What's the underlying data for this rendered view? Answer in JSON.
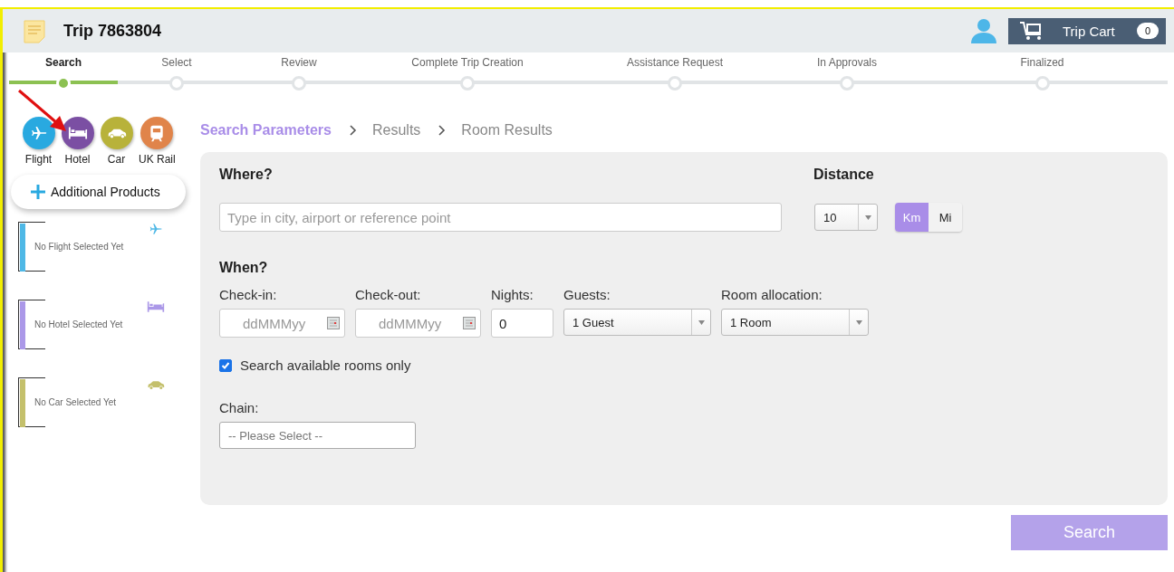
{
  "header": {
    "title": "Trip 7863804",
    "cart_label": "Trip Cart",
    "cart_count": "0"
  },
  "steps": [
    {
      "label": "Search",
      "selected": true
    },
    {
      "label": "Select",
      "selected": false
    },
    {
      "label": "Review",
      "selected": false
    },
    {
      "label": "Complete Trip Creation",
      "selected": false
    },
    {
      "label": "Assistance Request",
      "selected": false
    },
    {
      "label": "In Approvals",
      "selected": false
    },
    {
      "label": "Finalized",
      "selected": false
    }
  ],
  "products": [
    {
      "kind": "flight",
      "label": "Flight",
      "color": "#29a9e0"
    },
    {
      "kind": "hotel",
      "label": "Hotel",
      "color": "#7b4fa3"
    },
    {
      "kind": "car",
      "label": "Car",
      "color": "#b8b23a"
    },
    {
      "kind": "rail",
      "label": "UK Rail",
      "color": "#e0844a"
    }
  ],
  "additional_products": "Additional Products",
  "selections": [
    {
      "kind": "flight",
      "text": "No Flight Selected Yet",
      "color": "#4fb8e6"
    },
    {
      "kind": "hotel",
      "text": "No Hotel Selected Yet",
      "color": "#ab98e8"
    },
    {
      "kind": "car",
      "text": "No Car Selected Yet",
      "color": "#c4c06c"
    }
  ],
  "breadcrumb": [
    {
      "label": "Search Parameters",
      "selected": true
    },
    {
      "label": "Results",
      "selected": false
    },
    {
      "label": "Room Results",
      "selected": false
    }
  ],
  "form": {
    "where_label": "Where?",
    "where_placeholder": "Type in city, airport or reference point",
    "distance_label": "Distance",
    "distance_value": "10",
    "units": [
      {
        "label": "Km",
        "selected": true
      },
      {
        "label": "Mi",
        "selected": false
      }
    ],
    "when_label": "When?",
    "checkin_label": "Check-in:",
    "checkin_placeholder": "ddMMMyy",
    "checkout_label": "Check-out:",
    "checkout_placeholder": "ddMMMyy",
    "nights_label": "Nights:",
    "nights_value": "0",
    "guests_label": "Guests:",
    "guests_value": "1 Guest",
    "rooms_label": "Room allocation:",
    "rooms_value": "1 Room",
    "available_only": {
      "label": "Search available rooms only",
      "checked": true
    },
    "chain_label": "Chain:",
    "chain_value": "-- Please Select --"
  },
  "search_button": "Search"
}
